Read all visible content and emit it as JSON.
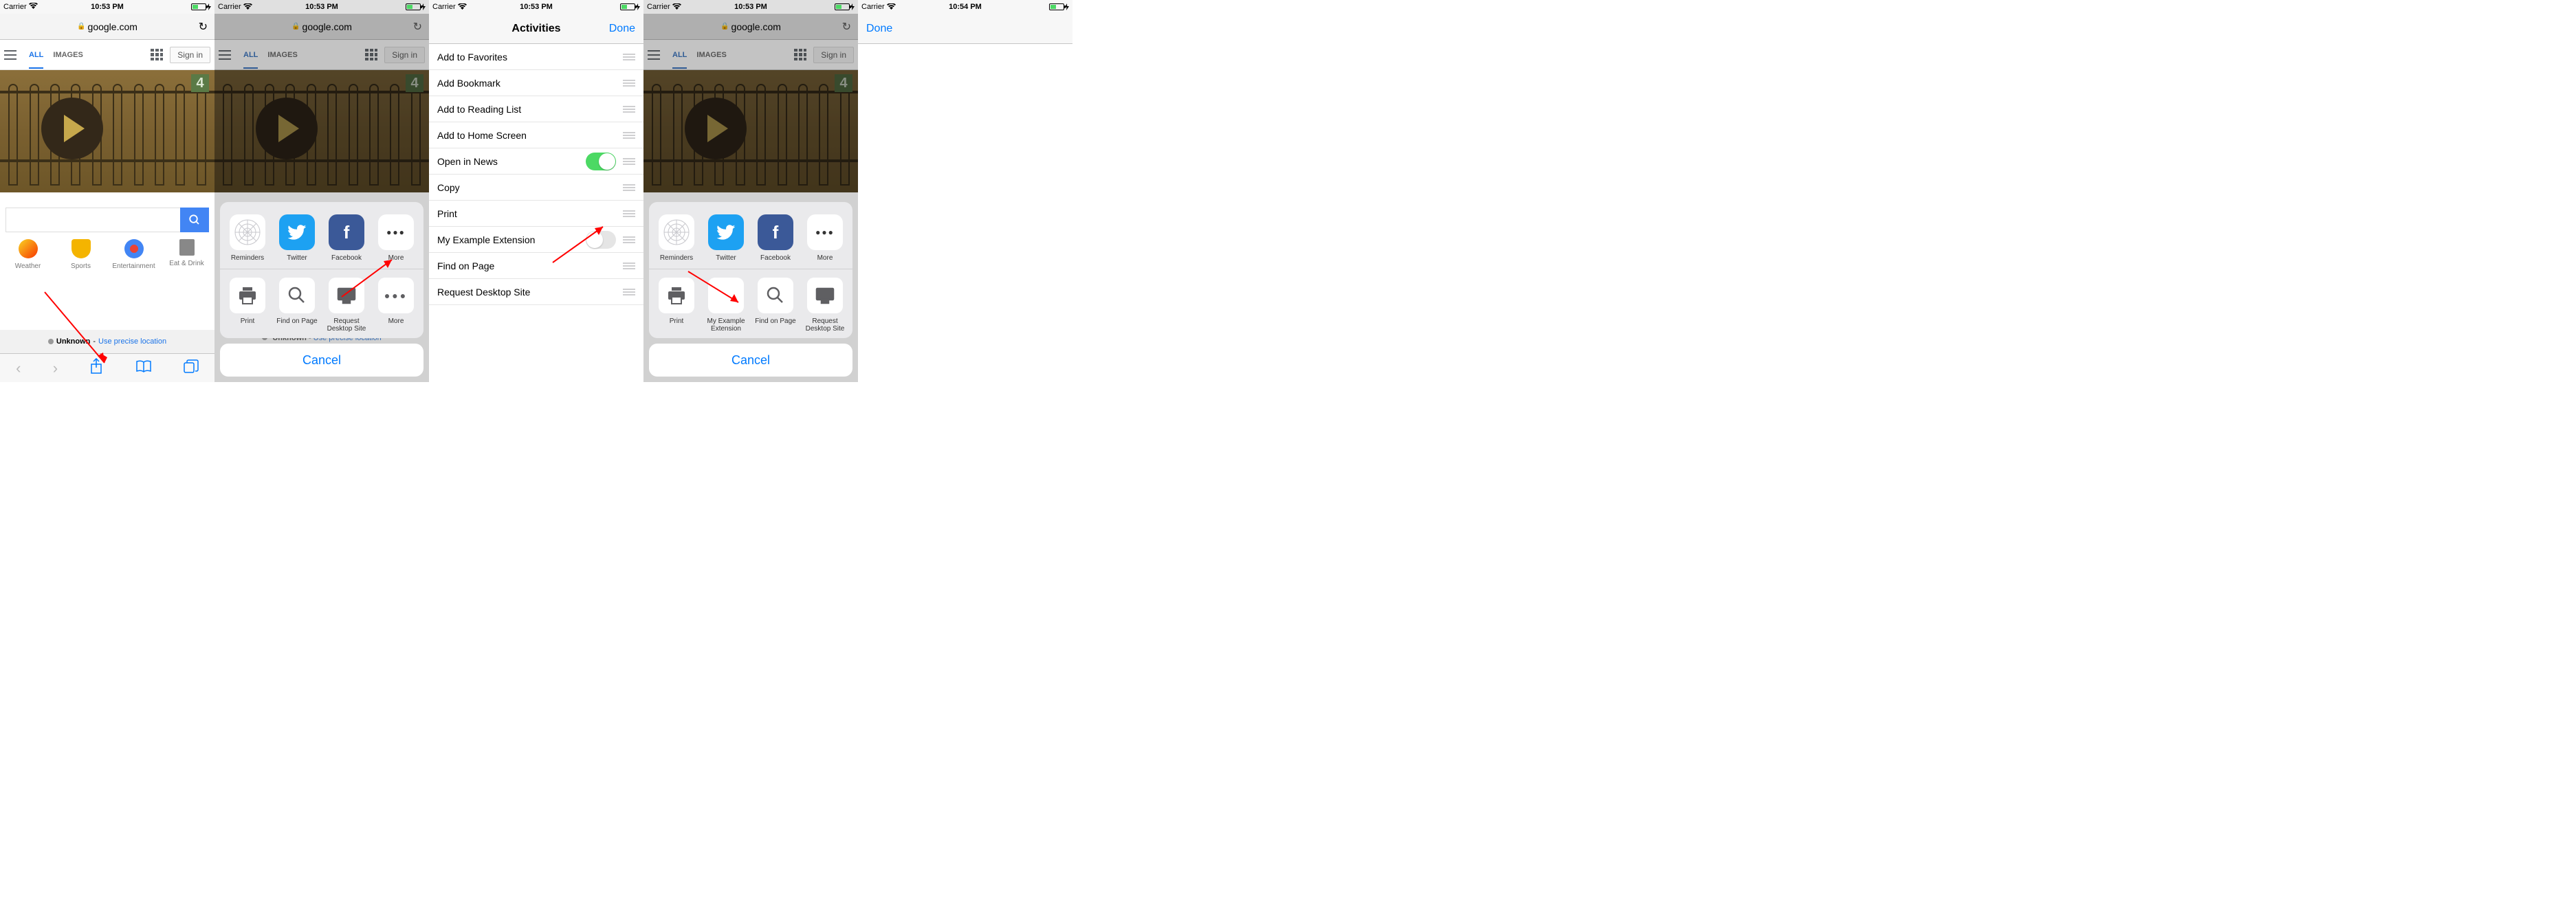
{
  "status": {
    "carrier": "Carrier",
    "time1": "10:53 PM",
    "time5": "10:54 PM"
  },
  "safari": {
    "url": "google.com"
  },
  "google": {
    "tab_all": "ALL",
    "tab_images": "IMAGES",
    "signin": "Sign in",
    "doodle_badge": "4",
    "cat_weather": "Weather",
    "cat_sports": "Sports",
    "cat_ent": "Entertainment",
    "cat_eat": "Eat & Drink",
    "loc_unknown": "Unknown",
    "loc_sep": " - ",
    "loc_link": "Use precise location"
  },
  "share": {
    "app_reminders": "Reminders",
    "app_twitter": "Twitter",
    "app_facebook": "Facebook",
    "app_more": "More",
    "act_print": "Print",
    "act_find": "Find on Page",
    "act_desktop": "Request Desktop Site",
    "act_myext": "My Example Extension",
    "cancel": "Cancel"
  },
  "activities": {
    "title": "Activities",
    "done": "Done",
    "rows": [
      "Add to Favorites",
      "Add Bookmark",
      "Add to Reading List",
      "Add to Home Screen",
      "Open in News",
      "Copy",
      "Print",
      "My Example Extension",
      "Find on Page",
      "Request Desktop Site"
    ]
  },
  "phone5": {
    "done": "Done"
  }
}
